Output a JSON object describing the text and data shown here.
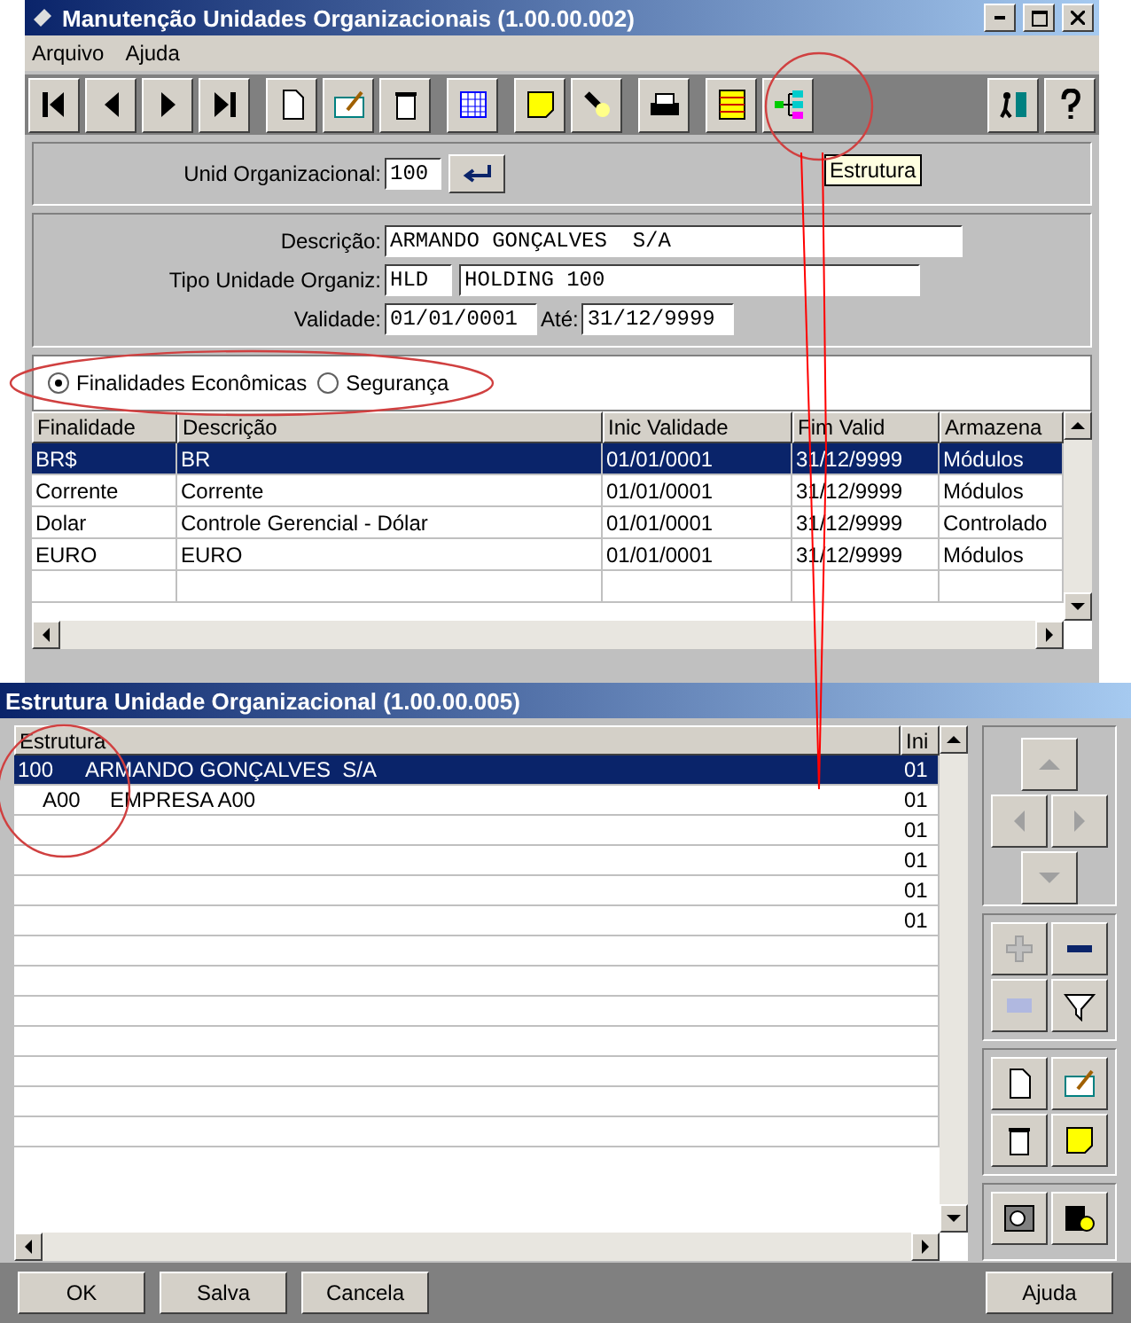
{
  "top_window": {
    "title": "Manutenção Unidades Organizacionais (1.00.00.002)",
    "menu": [
      "Arquivo",
      "Ajuda"
    ],
    "tooltip": "Estrutura",
    "unid": {
      "label": "Unid Organizacional:",
      "value": "100"
    },
    "form": {
      "descricao_label": "Descrição:",
      "descricao": "ARMANDO GONÇALVES  S/A",
      "tipo_label": "Tipo Unidade Organiz:",
      "tipo_code": "HLD",
      "tipo_name": "HOLDING 100",
      "validade_label": "Validade:",
      "validade_from": "01/01/0001",
      "ate_label": "Até:",
      "validade_to": "31/12/9999"
    },
    "radios": [
      {
        "label": "Finalidades Econômicas",
        "selected": true
      },
      {
        "label": "Segurança",
        "selected": false
      }
    ],
    "table": {
      "columns": [
        "Finalidade",
        "Descrição",
        "Inic Validade",
        "Fim Valid",
        "Armazena"
      ],
      "rows": [
        {
          "cells": [
            "BR$",
            "BR",
            "01/01/0001",
            "31/12/9999",
            "Módulos"
          ],
          "selected": true
        },
        {
          "cells": [
            "Corrente",
            "Corrente",
            "01/01/0001",
            "31/12/9999",
            "Módulos"
          ],
          "selected": false
        },
        {
          "cells": [
            "Dolar",
            "Controle Gerencial - Dólar",
            "01/01/0001",
            "31/12/9999",
            "Controlado"
          ],
          "selected": false
        },
        {
          "cells": [
            "EURO",
            "EURO",
            "01/01/0001",
            "31/12/9999",
            "Módulos"
          ],
          "selected": false
        }
      ]
    }
  },
  "bottom_window": {
    "title": "Estrutura Unidade Organizacional (1.00.00.005)",
    "columns": [
      "Estrutura",
      "Ini"
    ],
    "tree": [
      {
        "code": "100",
        "name": "ARMANDO GONÇALVES  S/A",
        "ini": "01",
        "selected": true,
        "children": [
          {
            "code": "A00",
            "name": "EMPRESA A00",
            "ini": "01",
            "selected": false
          }
        ]
      }
    ],
    "extra_ini": [
      "01",
      "01",
      "01",
      "01"
    ],
    "buttons": [
      "OK",
      "Salva",
      "Cancela",
      "Ajuda"
    ]
  }
}
